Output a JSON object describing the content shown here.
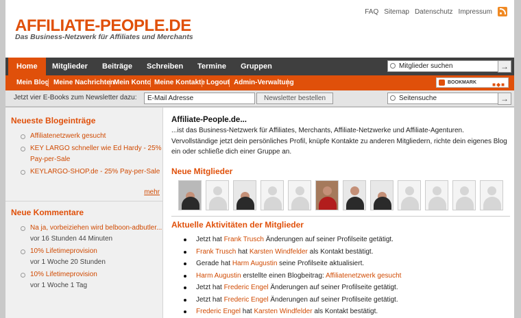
{
  "header": {
    "logo_title": "AFFILIATE-PEOPLE.DE",
    "logo_subtitle": "Das Business-Netzwerk für Affiliates und Merchants",
    "toplinks": [
      "FAQ",
      "Sitemap",
      "Datenschutz",
      "Impressum"
    ],
    "rss_icon": "rss-feed-icon"
  },
  "mainnav": {
    "items": [
      "Home",
      "Mitglieder",
      "Beiträge",
      "Schreiben",
      "Termine",
      "Gruppen"
    ],
    "active": "Home",
    "search_value": "Mitglieder suchen",
    "go_label": "→"
  },
  "subnav": {
    "items": [
      "Mein Blog",
      "Meine Nachrichten",
      "Mein Konto",
      "Meine Kontakte",
      "Logout",
      "Admin-Verwaltung"
    ],
    "bookmark_label": "BOOKMARK"
  },
  "newsletter": {
    "prefix": "Jetzt vier E-Books zum ",
    "link": "Newsletter",
    "suffix": " dazu:",
    "email_value": "E-Mail Adresse",
    "button_label": "Newsletter bestellen",
    "site_search_value": "Seitensuche",
    "go_label": "→"
  },
  "sidebar": {
    "blog_heading": "Neueste Blogeinträge",
    "blog_entries": [
      "Affiliatenetzwerk gesucht",
      "KEY LARGO schneller wie Ed Hardy - 25% Pay-per-Sale",
      "KEYLARGO-SHOP.de - 25% Pay-per-Sale"
    ],
    "more_label": "mehr",
    "comments_heading": "Neue Kommentare",
    "comments": [
      {
        "title": "Na ja, vorbeiziehen wird belboon-adbutler...",
        "time": "vor 16 Stunden 44 Minuten"
      },
      {
        "title": "10% Lifetimeprovision",
        "time": "vor 1 Woche 20 Stunden"
      },
      {
        "title": "10% Lifetimeprovision",
        "time": "vor 1 Woche 1 Tag"
      }
    ]
  },
  "main": {
    "intro_title": "Affiliate-People.de...",
    "intro_text": "...ist das Business-Netzwerk für Affiliates, Merchants, Affiliate-Netzwerke und Affiliate-Agenturen. Vervollständige jetzt dein persönliches Profil, knüpfe Kontakte zu anderen Mitgliedern, richte dein eigenes Blog ein oder schließe dich einer Gruppe an.",
    "members_heading": "Neue Mitglieder",
    "activities_heading": "Aktuelle Aktivitäten der Mitglieder",
    "activities": [
      {
        "pre": "Jetzt hat ",
        "link1": "Frank Trusch",
        "mid": " Änderungen auf seiner Profilseite getätigt.",
        "link2": "",
        "post": ""
      },
      {
        "pre": "",
        "link1": "Frank Trusch",
        "mid": " hat ",
        "link2": "Karsten Windfelder",
        "post": " als Kontakt bestätigt."
      },
      {
        "pre": "Gerade hat ",
        "link1": "Harm Augustin",
        "mid": " seine Profilseite aktualisiert.",
        "link2": "",
        "post": ""
      },
      {
        "pre": "",
        "link1": "Harm Augustin",
        "mid": " erstellte einen Blogbeitrag: ",
        "link2": "Affiliatenetzwerk gesucht",
        "post": ""
      },
      {
        "pre": "Jetzt hat ",
        "link1": "Frederic Engel",
        "mid": " Änderungen auf seiner Profilseite getätigt.",
        "link2": "",
        "post": ""
      },
      {
        "pre": "Jetzt hat ",
        "link1": "Frederic Engel",
        "mid": " Änderungen auf seiner Profilseite getätigt.",
        "link2": "",
        "post": ""
      },
      {
        "pre": "",
        "link1": "Frederic Engel",
        "mid": " hat ",
        "link2": "Karsten Windfelder",
        "post": " als Kontakt bestätigt."
      }
    ]
  },
  "colors": {
    "accent": "#e0500a",
    "nav_dark": "#3f3f3f",
    "link": "#d04a02"
  }
}
